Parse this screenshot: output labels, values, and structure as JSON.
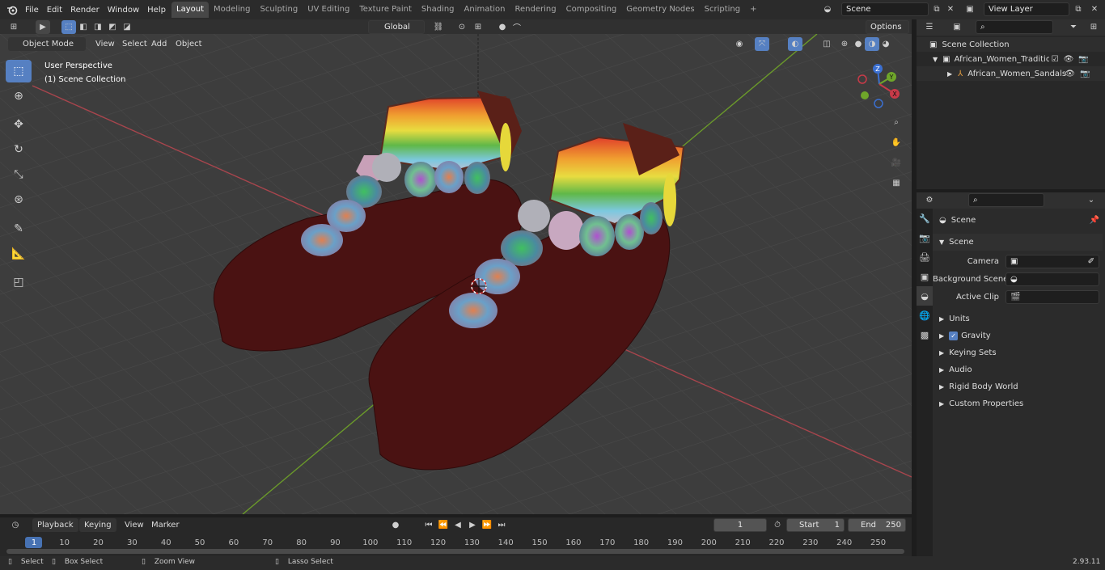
{
  "menu": {
    "items": [
      "File",
      "Edit",
      "Render",
      "Window",
      "Help"
    ]
  },
  "workspaces": {
    "tabs": [
      {
        "label": "Layout",
        "active": true
      },
      {
        "label": "Modeling"
      },
      {
        "label": "Sculpting"
      },
      {
        "label": "UV Editing"
      },
      {
        "label": "Texture Paint"
      },
      {
        "label": "Shading"
      },
      {
        "label": "Animation"
      },
      {
        "label": "Rendering"
      },
      {
        "label": "Compositing"
      },
      {
        "label": "Geometry Nodes"
      },
      {
        "label": "Scripting"
      }
    ],
    "add_label": "+"
  },
  "scene_selector": {
    "value": "Scene"
  },
  "view_layer": {
    "value": "View Layer"
  },
  "viewport_header": {
    "mode": "Object Mode",
    "view": "View",
    "select": "Select",
    "add": "Add",
    "object": "Object",
    "orientation": "Global",
    "options": "Options"
  },
  "viewport_overlay": {
    "perspective": "User Perspective",
    "collection": "(1) Scene Collection"
  },
  "gizmo": {
    "z": "Z",
    "y": "Y",
    "x": "X"
  },
  "outliner": {
    "rows": [
      {
        "label": "Scene Collection",
        "indent": 0
      },
      {
        "label": "African_Women_Traditional_C",
        "indent": 1
      },
      {
        "label": "African_Women_Sandals",
        "indent": 2
      }
    ]
  },
  "properties": {
    "context_title": "Scene",
    "panel_title": "Scene",
    "fields": [
      {
        "label": "Camera"
      },
      {
        "label": "Background Scene"
      },
      {
        "label": "Active Clip"
      }
    ],
    "sections": [
      "Units",
      "Gravity",
      "Keying Sets",
      "Audio",
      "Rigid Body World",
      "Custom Properties"
    ]
  },
  "timeline": {
    "playback": "Playback",
    "keying": "Keying",
    "view": "View",
    "marker": "Marker",
    "current_frame": "1",
    "start_label": "Start",
    "start_value": "1",
    "end_label": "End",
    "end_value": "250",
    "ticks": [
      "1",
      "10",
      "20",
      "30",
      "40",
      "50",
      "60",
      "70",
      "80",
      "90",
      "100",
      "110",
      "120",
      "130",
      "140",
      "150",
      "160",
      "170",
      "180",
      "190",
      "200",
      "210",
      "220",
      "230",
      "240",
      "250"
    ]
  },
  "statusbar": {
    "select": "Select",
    "box_select": "Box Select",
    "zoom_view": "Zoom View",
    "lasso_select": "Lasso Select",
    "version": "2.93.11"
  }
}
